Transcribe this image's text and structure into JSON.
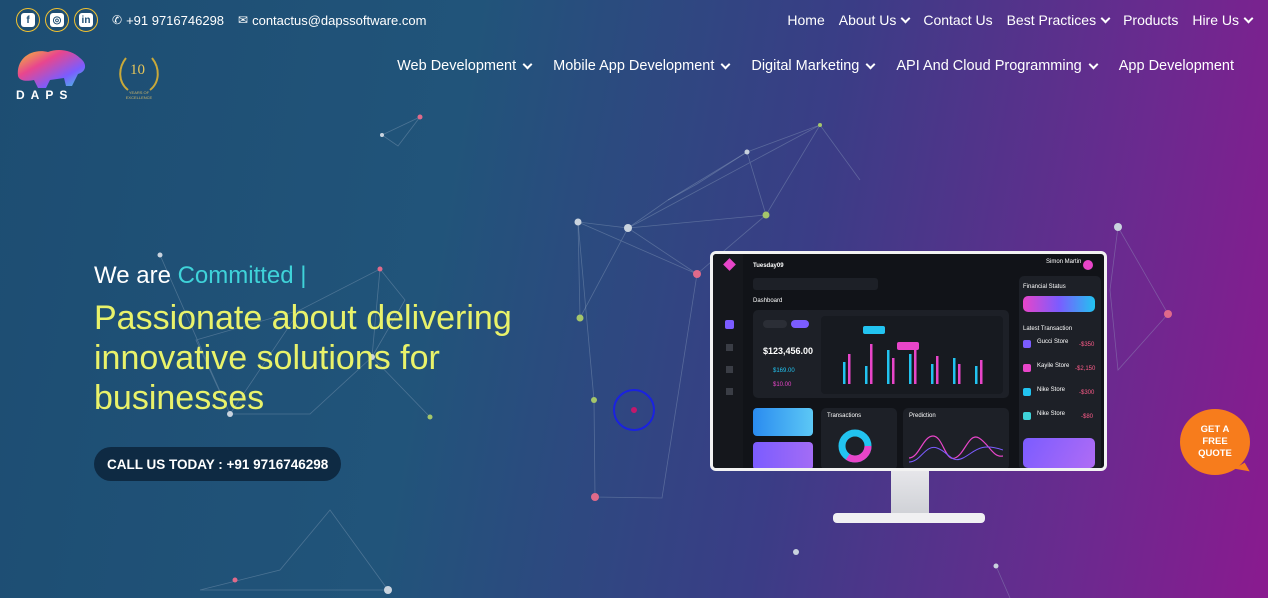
{
  "topbar": {
    "social": [
      {
        "name": "facebook-icon",
        "glyph": "f"
      },
      {
        "name": "instagram-icon",
        "glyph": "◎"
      },
      {
        "name": "linkedin-icon",
        "glyph": "in"
      }
    ],
    "phone": "+91 9716746298",
    "email": "contactus@dapssoftware.com",
    "nav": [
      {
        "label": "Home",
        "dropdown": false
      },
      {
        "label": "About Us",
        "dropdown": true
      },
      {
        "label": "Contact Us",
        "dropdown": false
      },
      {
        "label": "Best Practices",
        "dropdown": true
      },
      {
        "label": "Products",
        "dropdown": false
      },
      {
        "label": "Hire Us",
        "dropdown": true
      }
    ]
  },
  "brand": {
    "logo_text": "DAPS",
    "award_number": "10",
    "award_text": "YEARS OF EXCELLENCE"
  },
  "mainnav": [
    {
      "label": "Web Development",
      "dropdown": true
    },
    {
      "label": "Mobile App Development",
      "dropdown": true
    },
    {
      "label": "Digital Marketing",
      "dropdown": true
    },
    {
      "label": "API And Cloud Programming",
      "dropdown": true
    },
    {
      "label": "App Development",
      "dropdown": false
    }
  ],
  "hero": {
    "prefix": "We are ",
    "highlight": "Committed |",
    "headline": "Passionate about delivering innovative solutions for businesses",
    "cta": "CALL US TODAY : +91 9716746298"
  },
  "dashboard": {
    "date": "Tuesday09",
    "section": "Dashboard",
    "balance": "$123,456.00",
    "user": "Simon Martin",
    "financial": "Financial Status",
    "latest": "Latest Transaction",
    "transactions": [
      {
        "name": "Gucci Store",
        "amount": "-$350"
      },
      {
        "name": "Kayile Store",
        "amount": "-$2,150"
      },
      {
        "name": "Nike Store",
        "amount": "-$300"
      },
      {
        "name": "Nike Store",
        "amount": "-$80"
      }
    ],
    "transactions_label": "Transactions",
    "prediction_label": "Prediction",
    "sub_values": [
      "$169.00",
      "$10.00"
    ],
    "colors": {
      "cyan": "#22c3f0",
      "pink": "#e845c9",
      "purple": "#7b5cff"
    }
  },
  "quote": {
    "line1": "GET A",
    "line2": "FREE",
    "line3": "QUOTE"
  },
  "colors": {
    "highlight": "#3fd3d9",
    "headline": "#e9f26a",
    "accent": "#f2c230",
    "quote": "#f77c1c",
    "cta_bg": "#0e2a43"
  }
}
